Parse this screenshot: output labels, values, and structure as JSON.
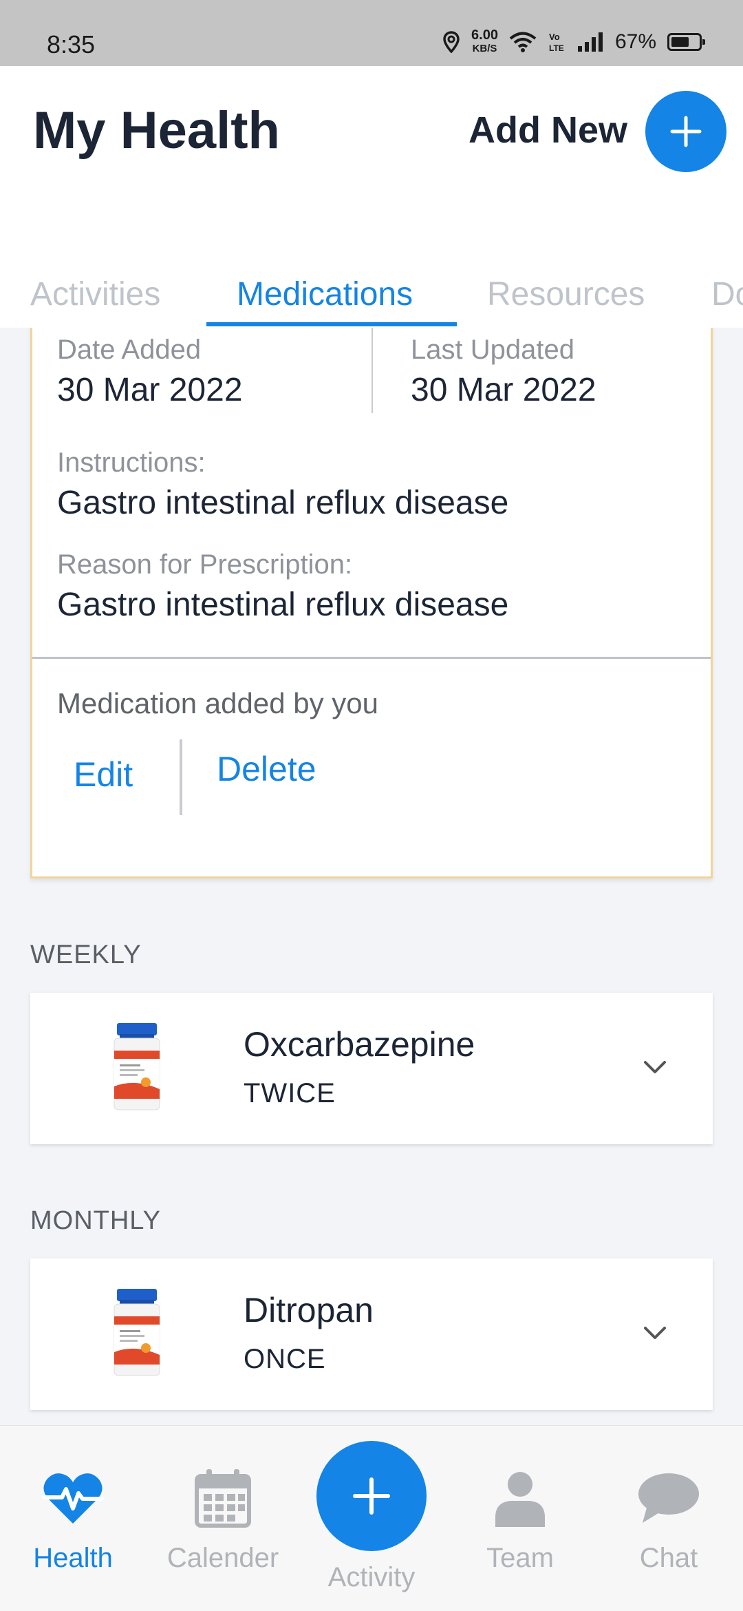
{
  "status_bar": {
    "time": "8:35",
    "speed_value": "6.00",
    "speed_unit": "KB/S",
    "battery_percent": "67%",
    "battery_level": 0.67
  },
  "header": {
    "title": "My Health",
    "add_new_label": "Add New",
    "accent": "#1484e6"
  },
  "tabs": [
    {
      "label": "Activities",
      "active": false
    },
    {
      "label": "Medications",
      "active": true
    },
    {
      "label": "Resources",
      "active": false
    },
    {
      "label": "Do",
      "active": false
    }
  ],
  "expanded_card": {
    "date_added_label": "Date Added",
    "date_added": "30 Mar 2022",
    "last_updated_label": "Last Updated",
    "last_updated": "30 Mar 2022",
    "instructions_label": "Instructions:",
    "instructions": "Gastro intestinal reflux disease",
    "reason_label": "Reason for Prescription:",
    "reason": "Gastro intestinal reflux disease",
    "added_by": "Medication added by you",
    "edit_label": "Edit",
    "delete_label": "Delete"
  },
  "sections": [
    {
      "label": "WEEKLY",
      "medication": {
        "name": "Oxcarbazepine",
        "frequency": "TWICE",
        "image_icon": "pill-bottle-icon"
      }
    },
    {
      "label": "MONTHLY",
      "medication": {
        "name": "Ditropan",
        "frequency": "ONCE",
        "image_icon": "pill-bottle-icon"
      }
    }
  ],
  "bottom_nav": {
    "items": [
      {
        "label": "Health",
        "icon": "heart-pulse-icon",
        "active": true
      },
      {
        "label": "Calender",
        "icon": "calendar-icon",
        "active": false
      },
      {
        "label": "Activity",
        "icon": "plus-icon",
        "active": false
      },
      {
        "label": "Team",
        "icon": "person-icon",
        "active": false
      },
      {
        "label": "Chat",
        "icon": "chat-bubble-icon",
        "active": false
      }
    ]
  }
}
